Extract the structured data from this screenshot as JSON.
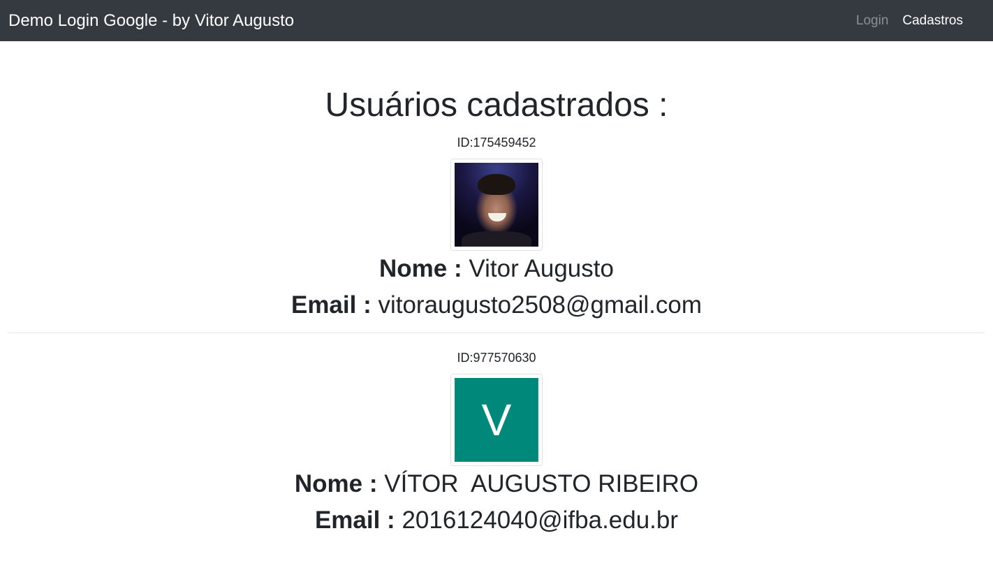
{
  "navbar": {
    "brand": "Demo Login Google - by Vitor Augusto",
    "links": [
      {
        "label": "Login",
        "active": false
      },
      {
        "label": "Cadastros",
        "active": true
      }
    ]
  },
  "page": {
    "title": "Usuários cadastrados :"
  },
  "users": [
    {
      "id_text": "ID:175459452",
      "avatar": "profile-photo",
      "nome_label": "Nome :",
      "nome": "Vitor Augusto",
      "email_label": "Email :",
      "email": "vitoraugusto2508@gmail.com"
    },
    {
      "id_text": "ID:977570630",
      "avatar_letter": "V",
      "avatar_color": "#00897b",
      "nome_label": "Nome :",
      "nome": "VÍTOR  AUGUSTO RIBEIRO",
      "email_label": "Email :",
      "email": "2016124040@ifba.edu.br"
    }
  ],
  "colors": {
    "navbar_bg": "#343a40",
    "text": "#212529",
    "avatar_teal": "#00897b"
  }
}
